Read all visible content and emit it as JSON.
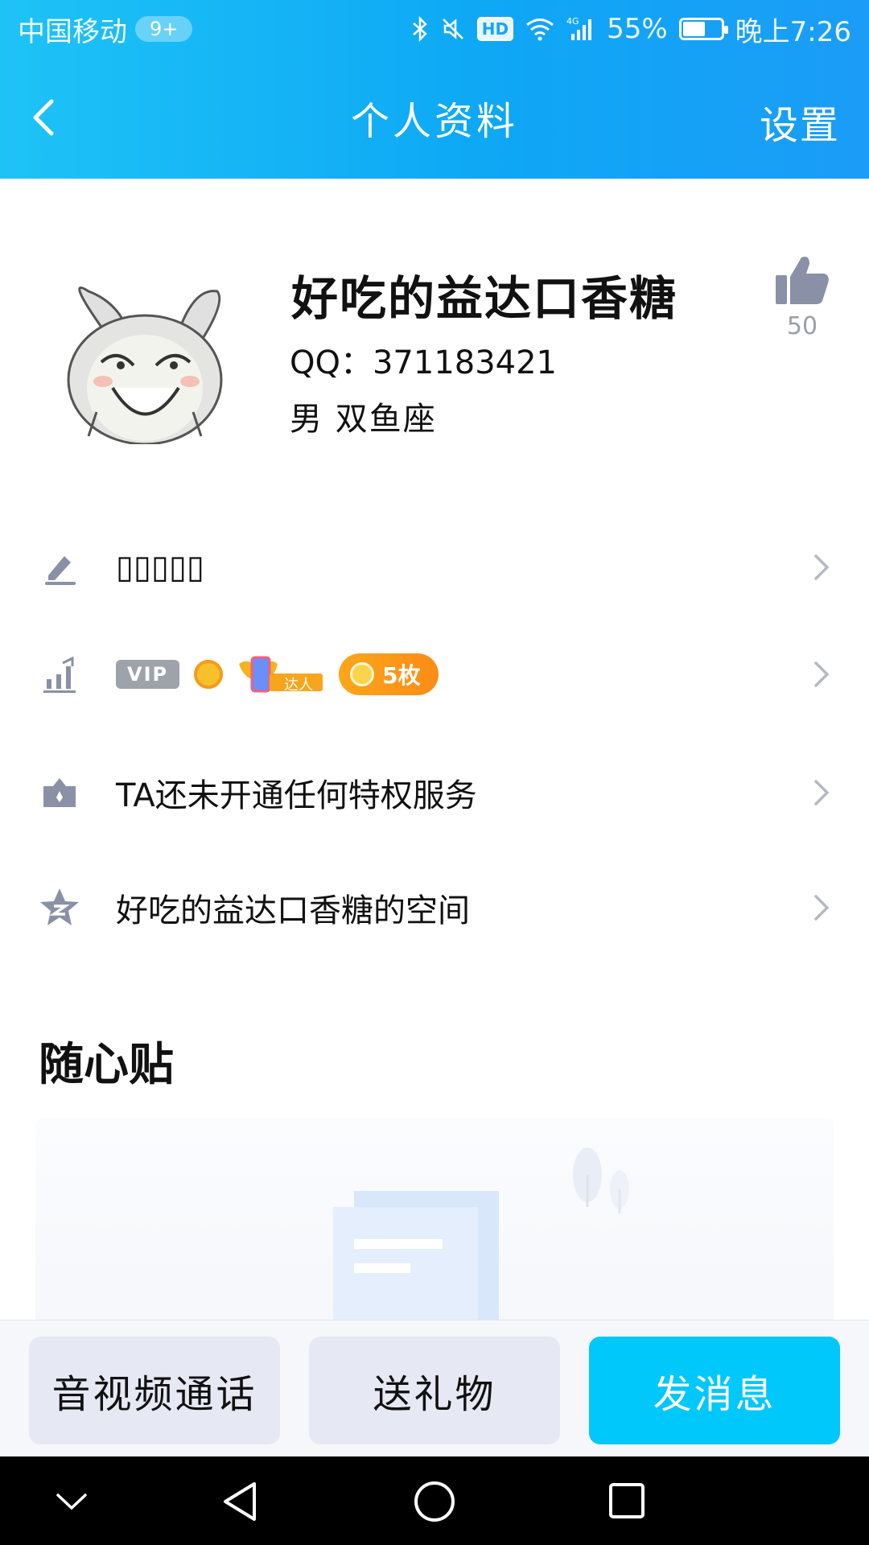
{
  "status_bar": {
    "carrier": "中国移动",
    "notification_badge": "9+",
    "hd_label": "HD",
    "network": "4G",
    "battery": "55%",
    "time": "晚上7:26",
    "icons": [
      "bluetooth-icon",
      "mute-icon",
      "hd-icon",
      "wifi-icon",
      "signal-icon",
      "battery-icon"
    ]
  },
  "nav": {
    "title": "个人资料",
    "right_label": "设置",
    "back_icon": "chevron-left-icon"
  },
  "profile": {
    "nickname": "好吃的益达口香糖",
    "qq": "QQ：371183421",
    "gender_zodiac": "男  双鱼座",
    "like_count": "50",
    "like_icon": "thumbs-up-icon",
    "avatar_icon": "rabbit-avatar-icon"
  },
  "rows": [
    {
      "icon": "edit-icon",
      "label": "▯▯▯▯▯"
    },
    {
      "icon": "level-icon",
      "badges": {
        "vip": "VIP",
        "daren": "达人",
        "medal": "5枚"
      }
    },
    {
      "icon": "crown-icon",
      "label": "TA还未开通任何特权服务"
    },
    {
      "icon": "qzone-star-icon",
      "label": "好吃的益达口香糖的空间"
    }
  ],
  "section": {
    "title": "随心贴"
  },
  "actions": {
    "call": "音视频通话",
    "gift": "送礼物",
    "message": "发消息"
  },
  "colors": {
    "header_start": "#1ec3f6",
    "header_end": "#1b9cf7",
    "accent": "#00c8fb",
    "gray_button": "#e6e9f3",
    "icon_gray": "#8a90a6",
    "medal_orange": "#fb9a18"
  }
}
